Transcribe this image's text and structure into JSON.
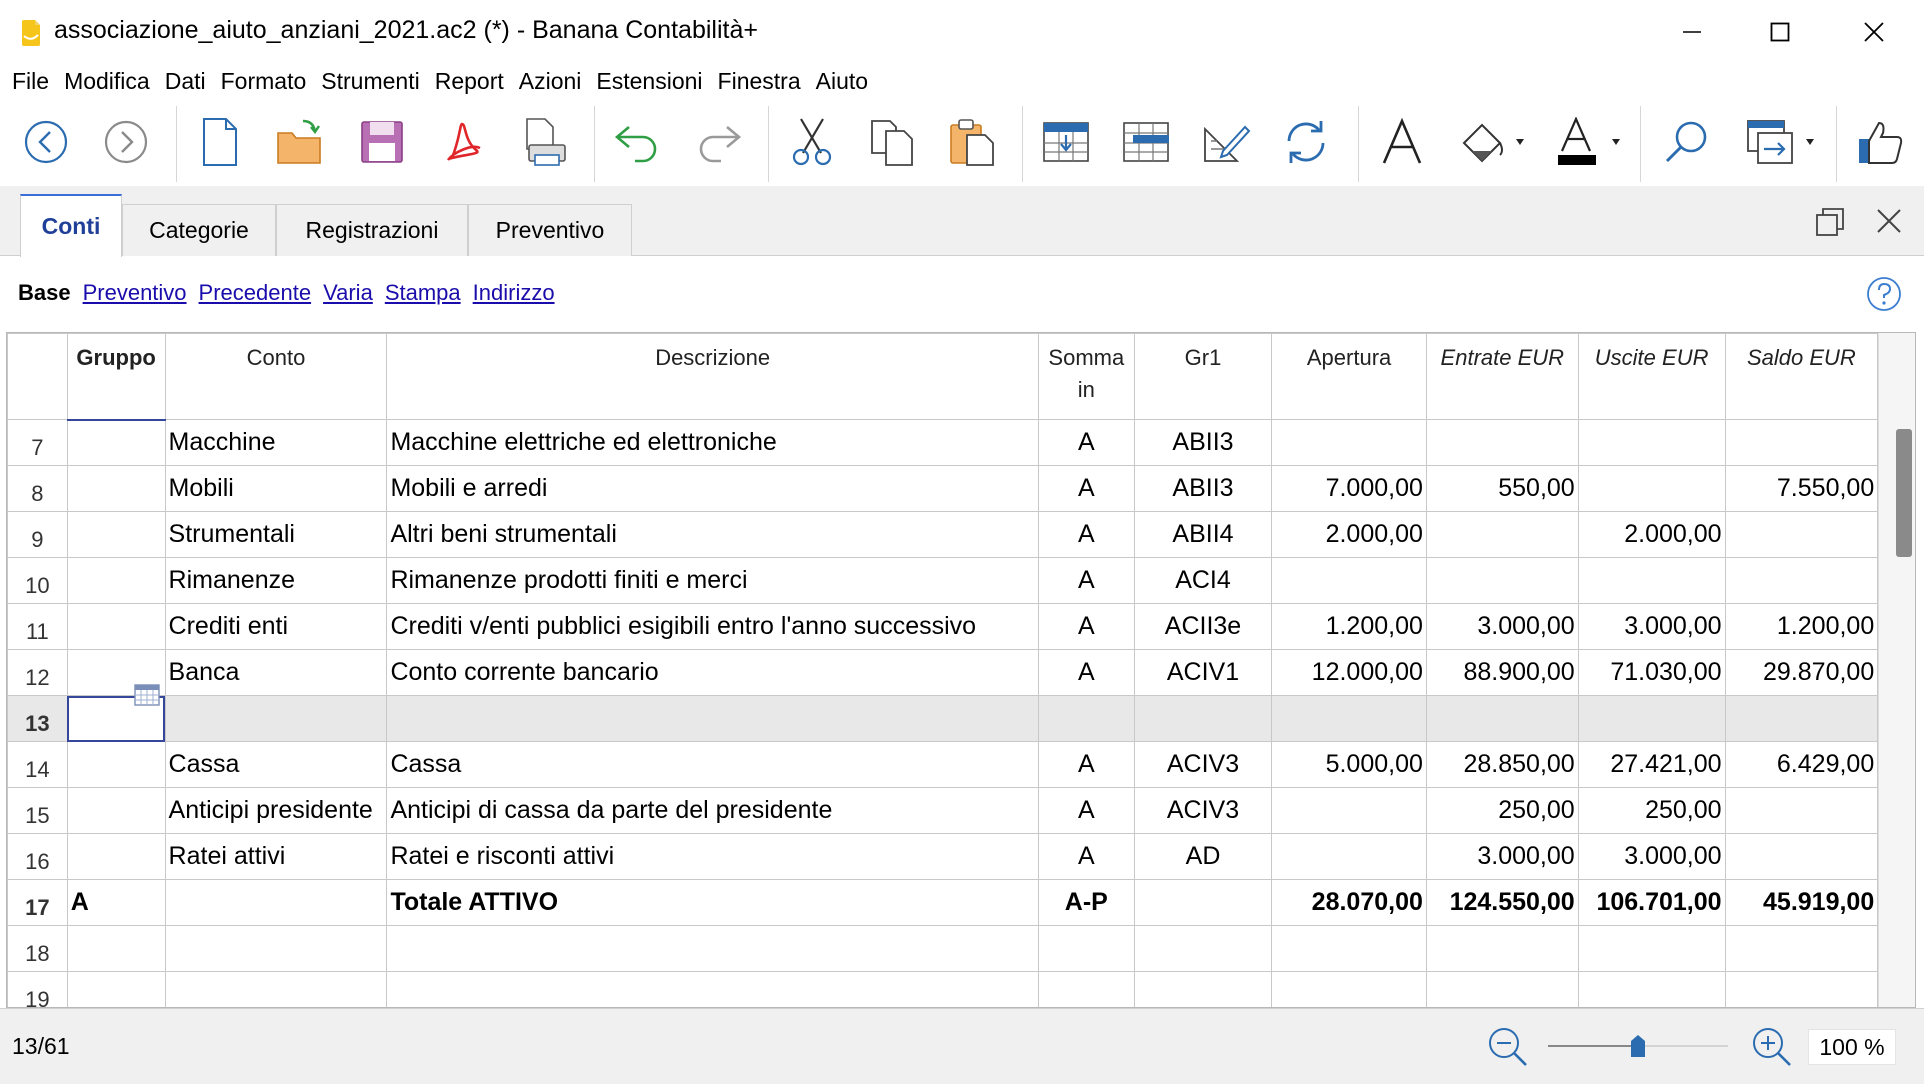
{
  "window": {
    "title": "associazione_aiuto_anziani_2021.ac2 (*) - Banana Contabilità+"
  },
  "menu": [
    "File",
    "Modifica",
    "Dati",
    "Formato",
    "Strumenti",
    "Report",
    "Azioni",
    "Estensioni",
    "Finestra",
    "Aiuto"
  ],
  "toolbar": {
    "icons": [
      "back-icon",
      "forward-icon",
      "new-file-icon",
      "open-folder-icon",
      "save-icon",
      "pdf-icon",
      "print-preview-icon",
      "undo-icon",
      "redo-icon",
      "cut-icon",
      "copy-icon",
      "paste-icon",
      "insert-row-icon",
      "add-rows-icon",
      "edit-row-icon",
      "recalculate-icon",
      "font-icon",
      "fill-color-icon",
      "text-color-icon",
      "search-icon",
      "window-arrange-icon",
      "feedback-icon"
    ]
  },
  "tabs": [
    {
      "label": "Conti",
      "active": true
    },
    {
      "label": "Categorie",
      "active": false
    },
    {
      "label": "Registrazioni",
      "active": false
    },
    {
      "label": "Preventivo",
      "active": false
    }
  ],
  "views": [
    "Base",
    "Preventivo",
    "Precedente",
    "Varia",
    "Stampa",
    "Indirizzo"
  ],
  "table": {
    "columns": [
      "Gruppo",
      "Conto",
      "Descrizione",
      "Somma in",
      "Gr1",
      "Apertura",
      "Entrate EUR",
      "Uscite EUR",
      "Saldo EUR"
    ],
    "rows": [
      {
        "n": "7",
        "gruppo": "",
        "conto": "Macchine",
        "descrizione": "Macchine elettriche ed elettroniche",
        "somma": "A",
        "gr1": "ABII3",
        "apertura": "",
        "entrate": "",
        "uscite": "",
        "saldo": ""
      },
      {
        "n": "8",
        "gruppo": "",
        "conto": "Mobili",
        "descrizione": "Mobili e arredi",
        "somma": "A",
        "gr1": "ABII3",
        "apertura": "7.000,00",
        "entrate": "550,00",
        "uscite": "",
        "saldo": "7.550,00"
      },
      {
        "n": "9",
        "gruppo": "",
        "conto": "Strumentali",
        "descrizione": "Altri beni strumentali",
        "somma": "A",
        "gr1": "ABII4",
        "apertura": "2.000,00",
        "entrate": "",
        "uscite": "2.000,00",
        "saldo": ""
      },
      {
        "n": "10",
        "gruppo": "",
        "conto": "Rimanenze",
        "descrizione": "Rimanenze prodotti finiti e merci",
        "somma": "A",
        "gr1": "ACI4",
        "apertura": "",
        "entrate": "",
        "uscite": "",
        "saldo": ""
      },
      {
        "n": "11",
        "gruppo": "",
        "conto": "Crediti enti",
        "descrizione": "Crediti v/enti pubblici esigibili entro l'anno successivo",
        "somma": "A",
        "gr1": "ACII3e",
        "apertura": "1.200,00",
        "entrate": "3.000,00",
        "uscite": "3.000,00",
        "saldo": "1.200,00"
      },
      {
        "n": "12",
        "gruppo": "",
        "conto": "Banca",
        "descrizione": "Conto corrente bancario",
        "somma": "A",
        "gr1": "ACIV1",
        "apertura": "12.000,00",
        "entrate": "88.900,00",
        "uscite": "71.030,00",
        "saldo": "29.870,00"
      },
      {
        "n": "13",
        "gruppo": "",
        "conto": "",
        "descrizione": "",
        "somma": "",
        "gr1": "",
        "apertura": "",
        "entrate": "",
        "uscite": "",
        "saldo": "",
        "selected": true
      },
      {
        "n": "14",
        "gruppo": "",
        "conto": "Cassa",
        "descrizione": "Cassa",
        "somma": "A",
        "gr1": "ACIV3",
        "apertura": "5.000,00",
        "entrate": "28.850,00",
        "uscite": "27.421,00",
        "saldo": "6.429,00"
      },
      {
        "n": "15",
        "gruppo": "",
        "conto": "Anticipi presidente",
        "descrizione": "Anticipi di cassa da parte del presidente",
        "somma": "A",
        "gr1": "ACIV3",
        "apertura": "",
        "entrate": "250,00",
        "uscite": "250,00",
        "saldo": ""
      },
      {
        "n": "16",
        "gruppo": "",
        "conto": "Ratei attivi",
        "descrizione": "Ratei e risconti attivi",
        "somma": "A",
        "gr1": "AD",
        "apertura": "",
        "entrate": "3.000,00",
        "uscite": "3.000,00",
        "saldo": ""
      },
      {
        "n": "17",
        "gruppo": "A",
        "conto": "",
        "descrizione": "Totale ATTIVO",
        "somma": "A-P",
        "gr1": "",
        "apertura": "28.070,00",
        "entrate": "124.550,00",
        "uscite": "106.701,00",
        "saldo": "45.919,00",
        "total": true
      },
      {
        "n": "18",
        "gruppo": "",
        "conto": "",
        "descrizione": "",
        "somma": "",
        "gr1": "",
        "apertura": "",
        "entrate": "",
        "uscite": "",
        "saldo": ""
      },
      {
        "n": "19",
        "gruppo": "",
        "conto": "",
        "descrizione": "",
        "somma": "",
        "gr1": "",
        "apertura": "",
        "entrate": "",
        "uscite": "",
        "saldo": ""
      }
    ]
  },
  "status": {
    "position": "13/61",
    "zoom": "100 %",
    "zoom_slider_fraction": 0.5
  },
  "colors": {
    "accent": "#3c6fd6",
    "link": "#1a0dab",
    "selected_row": "#e8e8e8",
    "cursor": "#34479a"
  }
}
